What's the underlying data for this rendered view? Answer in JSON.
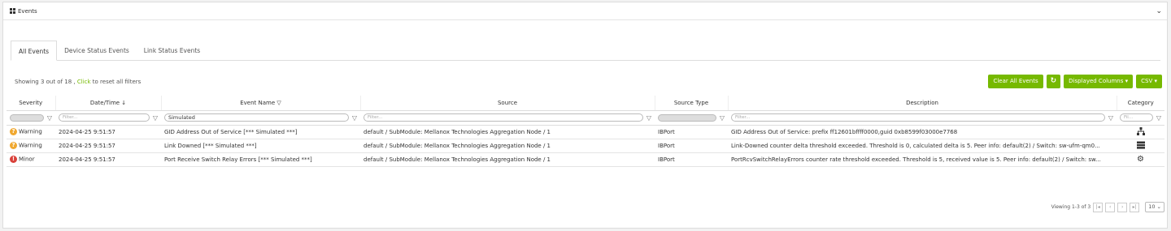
{
  "panel": {
    "title": "Events"
  },
  "tabs": [
    {
      "label": "All Events",
      "active": true
    },
    {
      "label": "Device Status Events",
      "active": false
    },
    {
      "label": "Link Status Events",
      "active": false
    }
  ],
  "summary": {
    "prefix": "Showing 3 out of 18 , ",
    "link": "Click",
    "suffix": " to reset all filters"
  },
  "toolbar": {
    "clear_label": "Clear All Events",
    "refresh_icon": "↻",
    "columns_label": "Displayed Columns ▾",
    "csv_label": "CSV ▾"
  },
  "columns": [
    "Severity",
    "Date/Time ↓",
    "Event Name ▽",
    "Source",
    "Source Type",
    "Description",
    "Category"
  ],
  "filters": {
    "placeholder": "Filter...",
    "event_name_value": "Simulated",
    "category_placeholder": "Fil..."
  },
  "rows": [
    {
      "severity": "Warning",
      "sev_icon": "?",
      "datetime": "2024-04-25 9:51:57",
      "event": "GID Address Out of Service [*** Simulated ***]",
      "source": "default / SubModule: Mellanox Technologies Aggregation Node / 1",
      "source_type": "IBPort",
      "description": "GID Address Out of Service: prefix ff12601bffff0000,guid 0xb8599f03000e7768",
      "category_icon": "network-icon"
    },
    {
      "severity": "Warning",
      "sev_icon": "?",
      "datetime": "2024-04-25 9:51:57",
      "event": "Link Downed [*** Simulated ***]",
      "source": "default / SubModule: Mellanox Technologies Aggregation Node / 1",
      "source_type": "IBPort",
      "description": "Link-Downed counter delta threshold exceeded. Threshold is 0, calculated delta is 5. Peer info: default(2) / Switch: sw-ufm-qm0...",
      "category_icon": "server-icon"
    },
    {
      "severity": "Minor",
      "sev_icon": "!",
      "datetime": "2024-04-25 9:51:57",
      "event": "Port Receive Switch Relay Errors [*** Simulated ***]",
      "source": "default / SubModule: Mellanox Technologies Aggregation Node / 1",
      "source_type": "IBPort",
      "description": "PortRcvSwitchRelayErrors counter rate threshold exceeded. Threshold is 5, received value is 5. Peer info: default(2) / Switch: sw...",
      "category_icon": "gears-icon"
    }
  ],
  "pager": {
    "viewing": "Viewing 1-3 of 3",
    "page_size": "10"
  }
}
